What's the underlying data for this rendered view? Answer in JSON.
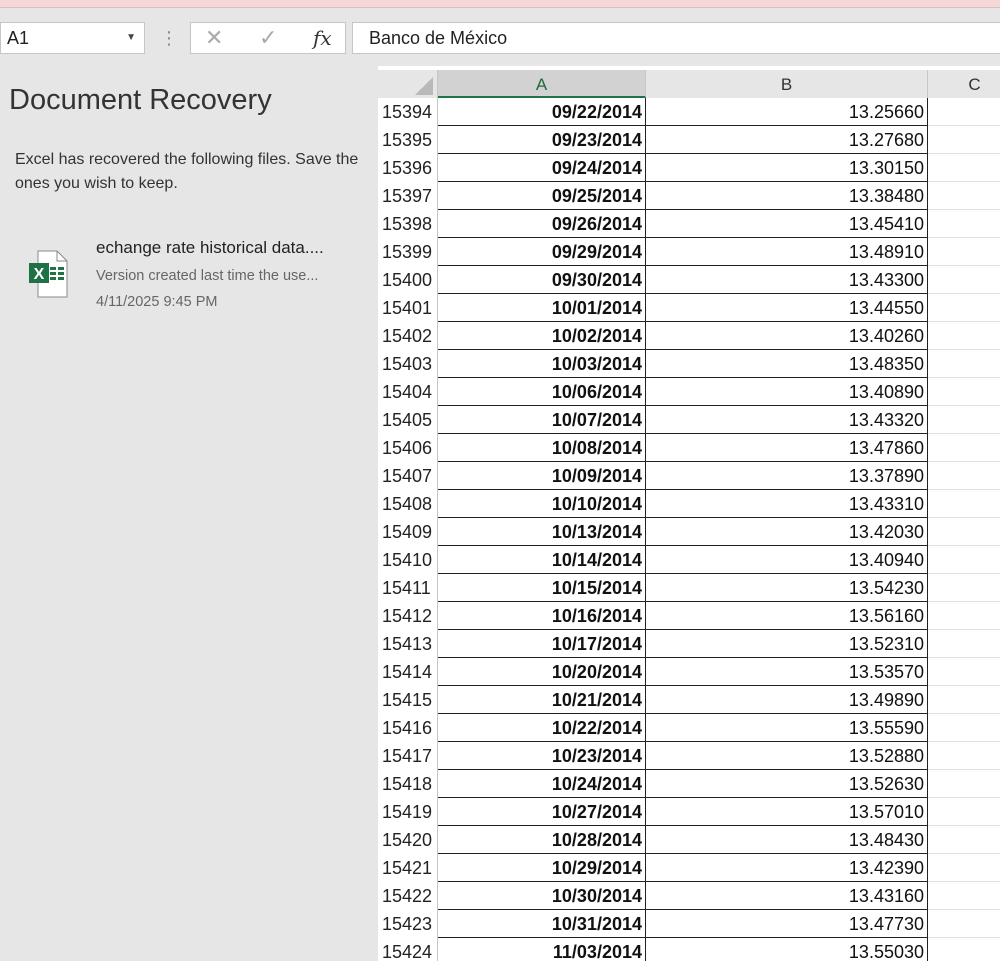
{
  "name_box": {
    "value": "A1"
  },
  "formula_bar": {
    "cancel_glyph": "✕",
    "enter_glyph": "✓",
    "fx_label": "fx",
    "content": "Banco de México"
  },
  "recovery": {
    "title": "Document Recovery",
    "message": "Excel has recovered the following files.  Save the ones you wish to keep.",
    "files": [
      {
        "name": "echange rate historical data....",
        "description": "Version created last time the use...",
        "time": "4/11/2025 9:45 PM",
        "icon": "excel-file-icon"
      }
    ]
  },
  "sheet": {
    "columns": [
      "A",
      "B",
      "C"
    ],
    "rows": [
      {
        "n": "15394",
        "a": "09/22/2014",
        "b": "13.25660"
      },
      {
        "n": "15395",
        "a": "09/23/2014",
        "b": "13.27680"
      },
      {
        "n": "15396",
        "a": "09/24/2014",
        "b": "13.30150"
      },
      {
        "n": "15397",
        "a": "09/25/2014",
        "b": "13.38480"
      },
      {
        "n": "15398",
        "a": "09/26/2014",
        "b": "13.45410"
      },
      {
        "n": "15399",
        "a": "09/29/2014",
        "b": "13.48910"
      },
      {
        "n": "15400",
        "a": "09/30/2014",
        "b": "13.43300"
      },
      {
        "n": "15401",
        "a": "10/01/2014",
        "b": "13.44550"
      },
      {
        "n": "15402",
        "a": "10/02/2014",
        "b": "13.40260"
      },
      {
        "n": "15403",
        "a": "10/03/2014",
        "b": "13.48350"
      },
      {
        "n": "15404",
        "a": "10/06/2014",
        "b": "13.40890"
      },
      {
        "n": "15405",
        "a": "10/07/2014",
        "b": "13.43320"
      },
      {
        "n": "15406",
        "a": "10/08/2014",
        "b": "13.47860"
      },
      {
        "n": "15407",
        "a": "10/09/2014",
        "b": "13.37890"
      },
      {
        "n": "15408",
        "a": "10/10/2014",
        "b": "13.43310"
      },
      {
        "n": "15409",
        "a": "10/13/2014",
        "b": "13.42030"
      },
      {
        "n": "15410",
        "a": "10/14/2014",
        "b": "13.40940"
      },
      {
        "n": "15411",
        "a": "10/15/2014",
        "b": "13.54230"
      },
      {
        "n": "15412",
        "a": "10/16/2014",
        "b": "13.56160"
      },
      {
        "n": "15413",
        "a": "10/17/2014",
        "b": "13.52310"
      },
      {
        "n": "15414",
        "a": "10/20/2014",
        "b": "13.53570"
      },
      {
        "n": "15415",
        "a": "10/21/2014",
        "b": "13.49890"
      },
      {
        "n": "15416",
        "a": "10/22/2014",
        "b": "13.55590"
      },
      {
        "n": "15417",
        "a": "10/23/2014",
        "b": "13.52880"
      },
      {
        "n": "15418",
        "a": "10/24/2014",
        "b": "13.52630"
      },
      {
        "n": "15419",
        "a": "10/27/2014",
        "b": "13.57010"
      },
      {
        "n": "15420",
        "a": "10/28/2014",
        "b": "13.48430"
      },
      {
        "n": "15421",
        "a": "10/29/2014",
        "b": "13.42390"
      },
      {
        "n": "15422",
        "a": "10/30/2014",
        "b": "13.43160"
      },
      {
        "n": "15423",
        "a": "10/31/2014",
        "b": "13.47730"
      },
      {
        "n": "15424",
        "a": "11/03/2014",
        "b": "13.55030"
      }
    ]
  },
  "colors": {
    "excel_green": "#217346",
    "selected_header_text": "#1e6b3c"
  }
}
